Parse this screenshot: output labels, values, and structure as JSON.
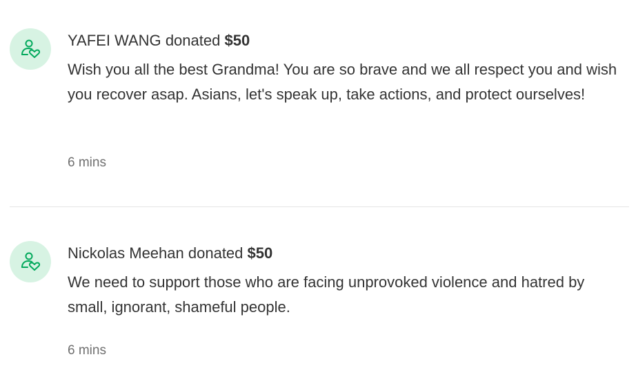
{
  "donations": [
    {
      "name": "YAFEI WANG",
      "verb": "donated",
      "amount": "$50",
      "message": "Wish you all the best Grandma! You are so brave and we all respect you and wish you recover asap. Asians, let's speak up, take actions, and protect ourselves!",
      "time": "6 mins",
      "icon": "donor-heart-icon"
    },
    {
      "name": "Nickolas Meehan",
      "verb": "donated",
      "amount": "$50",
      "message": "We need to support those who are facing unprovoked violence and hatred by small, ignorant, shameful people.",
      "time": "6 mins",
      "icon": "donor-heart-icon"
    }
  ],
  "colors": {
    "avatar_bg": "#d7f3e3",
    "icon_stroke": "#02a95c",
    "text": "#333333",
    "muted": "#6f6f6f",
    "divider": "#e4e4e4"
  }
}
